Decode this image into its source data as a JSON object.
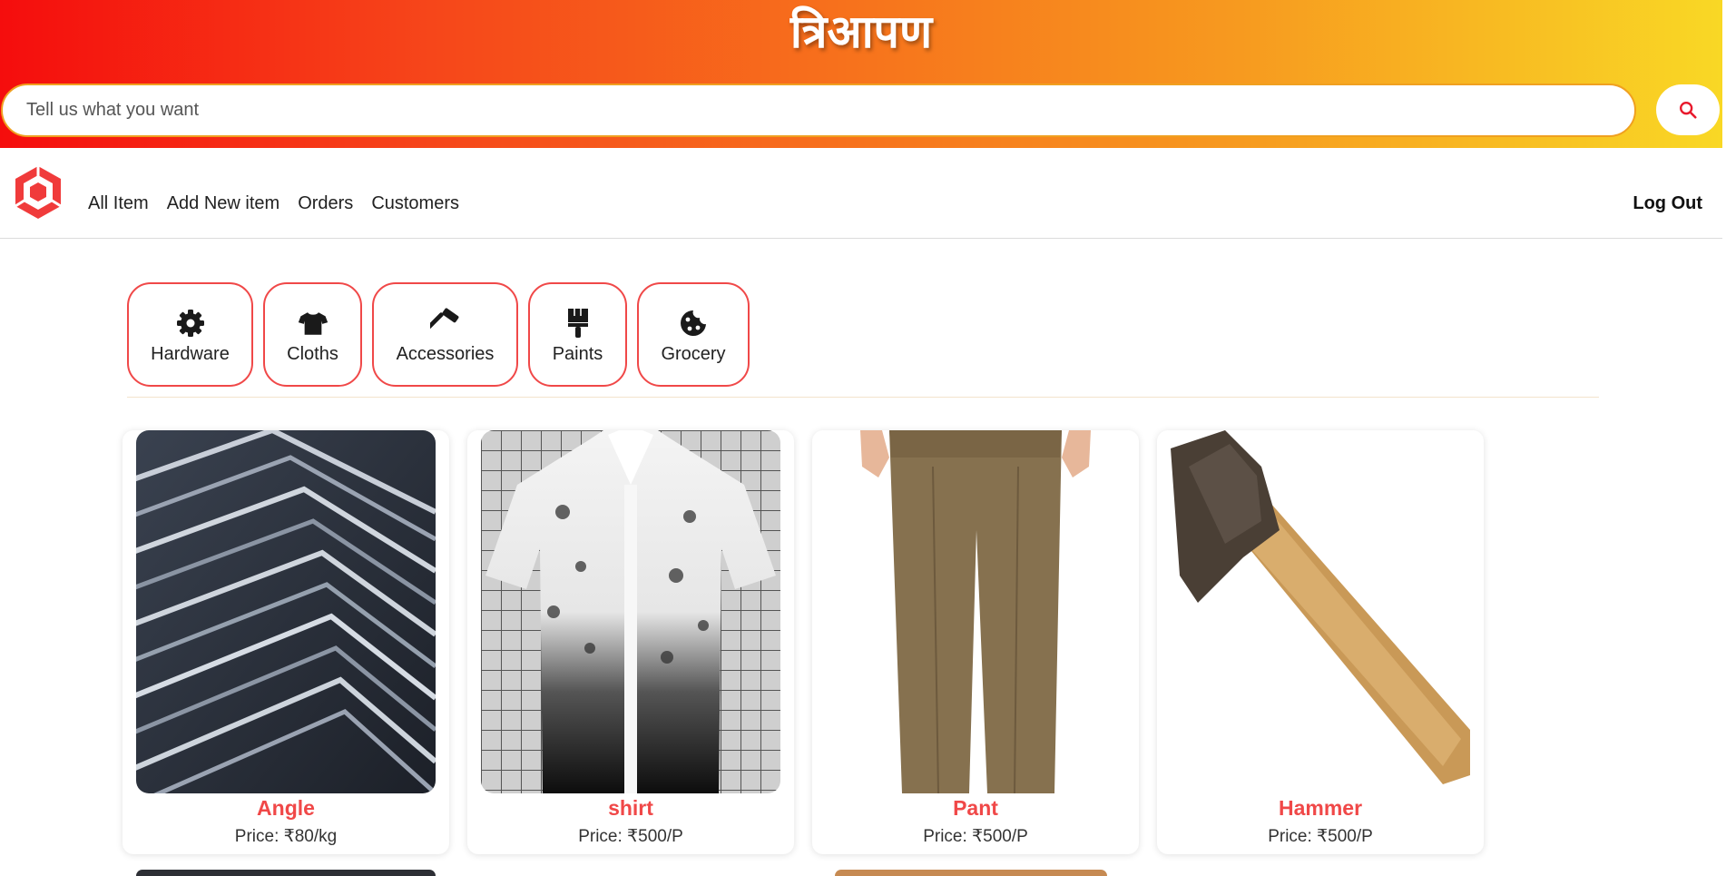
{
  "header": {
    "brand": "त्रिआपण",
    "search_placeholder": "Tell us what you want",
    "search_value": ""
  },
  "nav": {
    "items": [
      {
        "label": "All Item"
      },
      {
        "label": "Add New item"
      },
      {
        "label": "Orders"
      },
      {
        "label": "Customers"
      }
    ],
    "logout": "Log Out"
  },
  "categories": [
    {
      "label": "Hardware",
      "icon": "gear-icon"
    },
    {
      "label": "Cloths",
      "icon": "tshirt-icon"
    },
    {
      "label": "Accessories",
      "icon": "hammer-icon"
    },
    {
      "label": "Paints",
      "icon": "paint-brush-icon"
    },
    {
      "label": "Grocery",
      "icon": "cookie-icon"
    }
  ],
  "products": [
    {
      "name": "Angle",
      "price": "Price: ₹80/kg"
    },
    {
      "name": "shirt",
      "price": "Price: ₹500/P"
    },
    {
      "name": "Pant",
      "price": "Price: ₹500/P"
    },
    {
      "name": "Hammer",
      "price": "Price: ₹500/P"
    }
  ],
  "colors": {
    "accent": "#f04848",
    "gradient_start": "#f50d0d",
    "gradient_end": "#f9d825"
  }
}
